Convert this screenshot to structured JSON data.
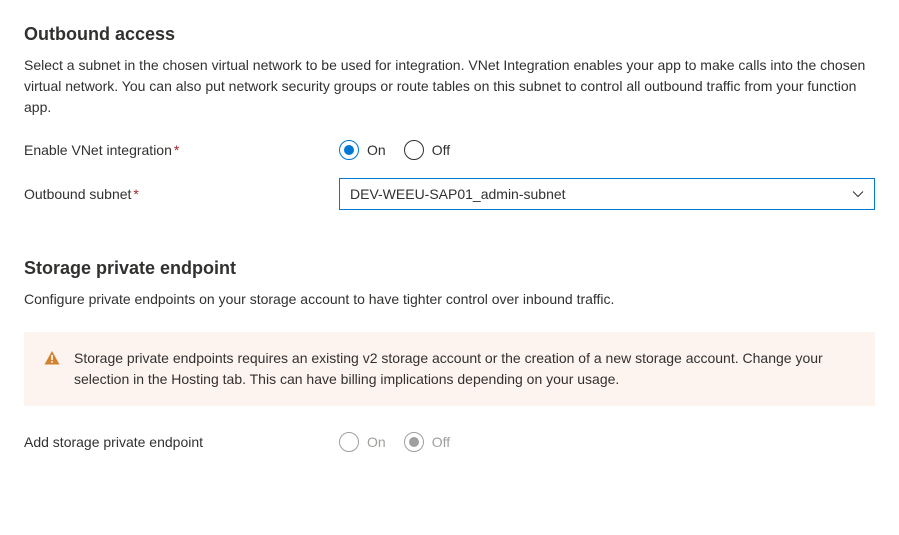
{
  "outbound": {
    "title": "Outbound access",
    "description": "Select a subnet in the chosen virtual network to be used for integration. VNet Integration enables your app to make calls into the chosen virtual network. You can also put network security groups or route tables on this subnet to control all outbound traffic from your function app.",
    "enable_vnet": {
      "label": "Enable VNet integration",
      "on": "On",
      "off": "Off",
      "selected": "on"
    },
    "subnet": {
      "label": "Outbound subnet",
      "selected": "DEV-WEEU-SAP01_admin-subnet"
    }
  },
  "storage_pe": {
    "title": "Storage private endpoint",
    "description": "Configure private endpoints on your storage account to have tighter control over inbound traffic.",
    "alert": "Storage private endpoints requires an existing v2 storage account or the creation of a new storage account. Change your selection in the Hosting tab. This can have billing implications depending on your usage.",
    "add_pe": {
      "label": "Add storage private endpoint",
      "on": "On",
      "off": "Off",
      "selected": "off",
      "disabled": true
    }
  }
}
